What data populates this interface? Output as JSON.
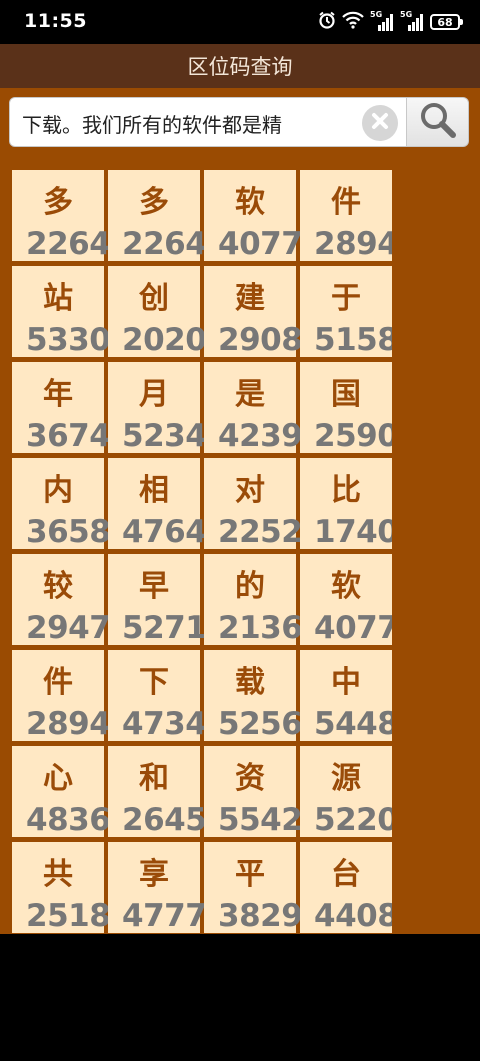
{
  "status": {
    "time": "11:55",
    "net1": "5G",
    "net2": "5G",
    "battery": "68"
  },
  "app": {
    "title": "区位码查询"
  },
  "search": {
    "value": "下载。我们所有的软件都是精"
  },
  "colors": {
    "title_bar": "#5a3119",
    "content_bg": "#9a4b02",
    "cell_bg": "#ffe8c4",
    "char_color": "#9a4b08",
    "code_color": "#777777"
  },
  "cells": [
    {
      "ch": "多",
      "code": "2264"
    },
    {
      "ch": "多",
      "code": "2264"
    },
    {
      "ch": "软",
      "code": "4077"
    },
    {
      "ch": "件",
      "code": "2894"
    },
    {
      "ch": "站",
      "code": "5330"
    },
    {
      "ch": "创",
      "code": "2020"
    },
    {
      "ch": "建",
      "code": "2908"
    },
    {
      "ch": "于",
      "code": "5158"
    },
    {
      "ch": "年",
      "code": "3674"
    },
    {
      "ch": "月",
      "code": "5234"
    },
    {
      "ch": "是",
      "code": "4239"
    },
    {
      "ch": "国",
      "code": "2590"
    },
    {
      "ch": "内",
      "code": "3658"
    },
    {
      "ch": "相",
      "code": "4764"
    },
    {
      "ch": "对",
      "code": "2252"
    },
    {
      "ch": "比",
      "code": "1740"
    },
    {
      "ch": "较",
      "code": "2947"
    },
    {
      "ch": "早",
      "code": "5271"
    },
    {
      "ch": "的",
      "code": "2136"
    },
    {
      "ch": "软",
      "code": "4077"
    },
    {
      "ch": "件",
      "code": "2894"
    },
    {
      "ch": "下",
      "code": "4734"
    },
    {
      "ch": "载",
      "code": "5256"
    },
    {
      "ch": "中",
      "code": "5448"
    },
    {
      "ch": "心",
      "code": "4836"
    },
    {
      "ch": "和",
      "code": "2645"
    },
    {
      "ch": "资",
      "code": "5542"
    },
    {
      "ch": "源",
      "code": "5220"
    },
    {
      "ch": "共",
      "code": "2518"
    },
    {
      "ch": "享",
      "code": "4777"
    },
    {
      "ch": "平",
      "code": "3829"
    },
    {
      "ch": "台",
      "code": "4408"
    }
  ]
}
